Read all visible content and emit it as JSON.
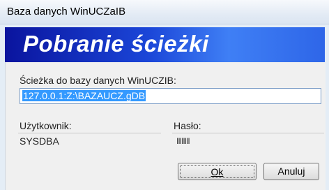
{
  "window": {
    "title": "Baza danych WinUCZaIB"
  },
  "banner": {
    "heading": "Pobranie ścieżki"
  },
  "form": {
    "path_label": "Ścieżka do bazy danych WinUCZIB:",
    "path_value": "127.0.0.1:Z:\\BAZAUCZ.gDB",
    "user_label": "Użytkownik:",
    "user_value": "SYSDBA",
    "password_label": "Hasło:",
    "password_mask": "IIIIIIII"
  },
  "buttons": {
    "ok_label": "Ok",
    "cancel_label": "Anuluj"
  },
  "colors": {
    "banner_dark": "#0a149e",
    "banner_light": "#3f7ff5",
    "selection": "#3399ff"
  }
}
